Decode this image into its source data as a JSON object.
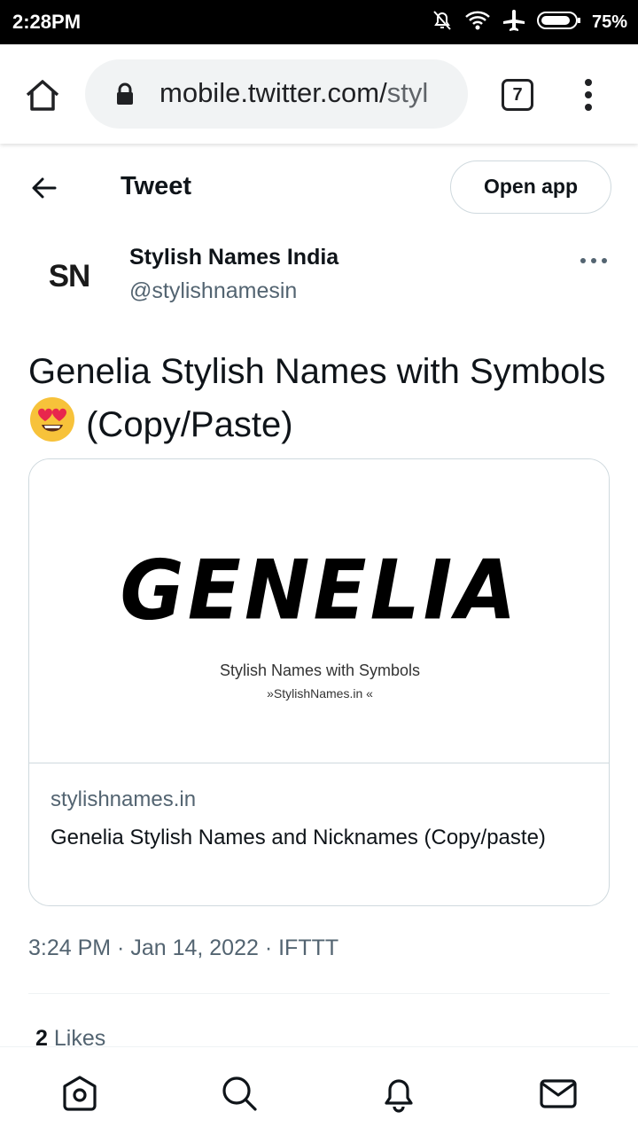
{
  "status_bar": {
    "time": "2:28PM",
    "battery": "75%"
  },
  "browser": {
    "url_main": "mobile.twitter.com/",
    "url_dim": "styl",
    "tab_count": "7"
  },
  "header": {
    "title": "Tweet",
    "open_app_label": "Open app"
  },
  "author": {
    "avatar_text": "SN",
    "name": "Stylish Names India",
    "handle": "@stylishnamesin"
  },
  "tweet": {
    "text_before_emoji": "Genelia Stylish Names with Symbols ",
    "text_after_emoji": " (Copy/Paste)",
    "emoji": "heart-eyes-emoji"
  },
  "card": {
    "image_title": "GENELIA",
    "image_subtitle": "Stylish Names with Symbols",
    "image_site": "»StylishNames.in «",
    "domain": "stylishnames.in",
    "title": "Genelia Stylish Names and Nicknames (Copy/paste)"
  },
  "meta": {
    "text": "3:24 PM · Jan 14, 2022 · IFTTT"
  },
  "likes": {
    "count": "2",
    "label": "Likes"
  },
  "nav": [
    "home-icon",
    "search-icon",
    "notifications-icon",
    "messages-icon"
  ],
  "colors": {
    "secondary_text": "#536471",
    "border": "#cfd9de"
  }
}
